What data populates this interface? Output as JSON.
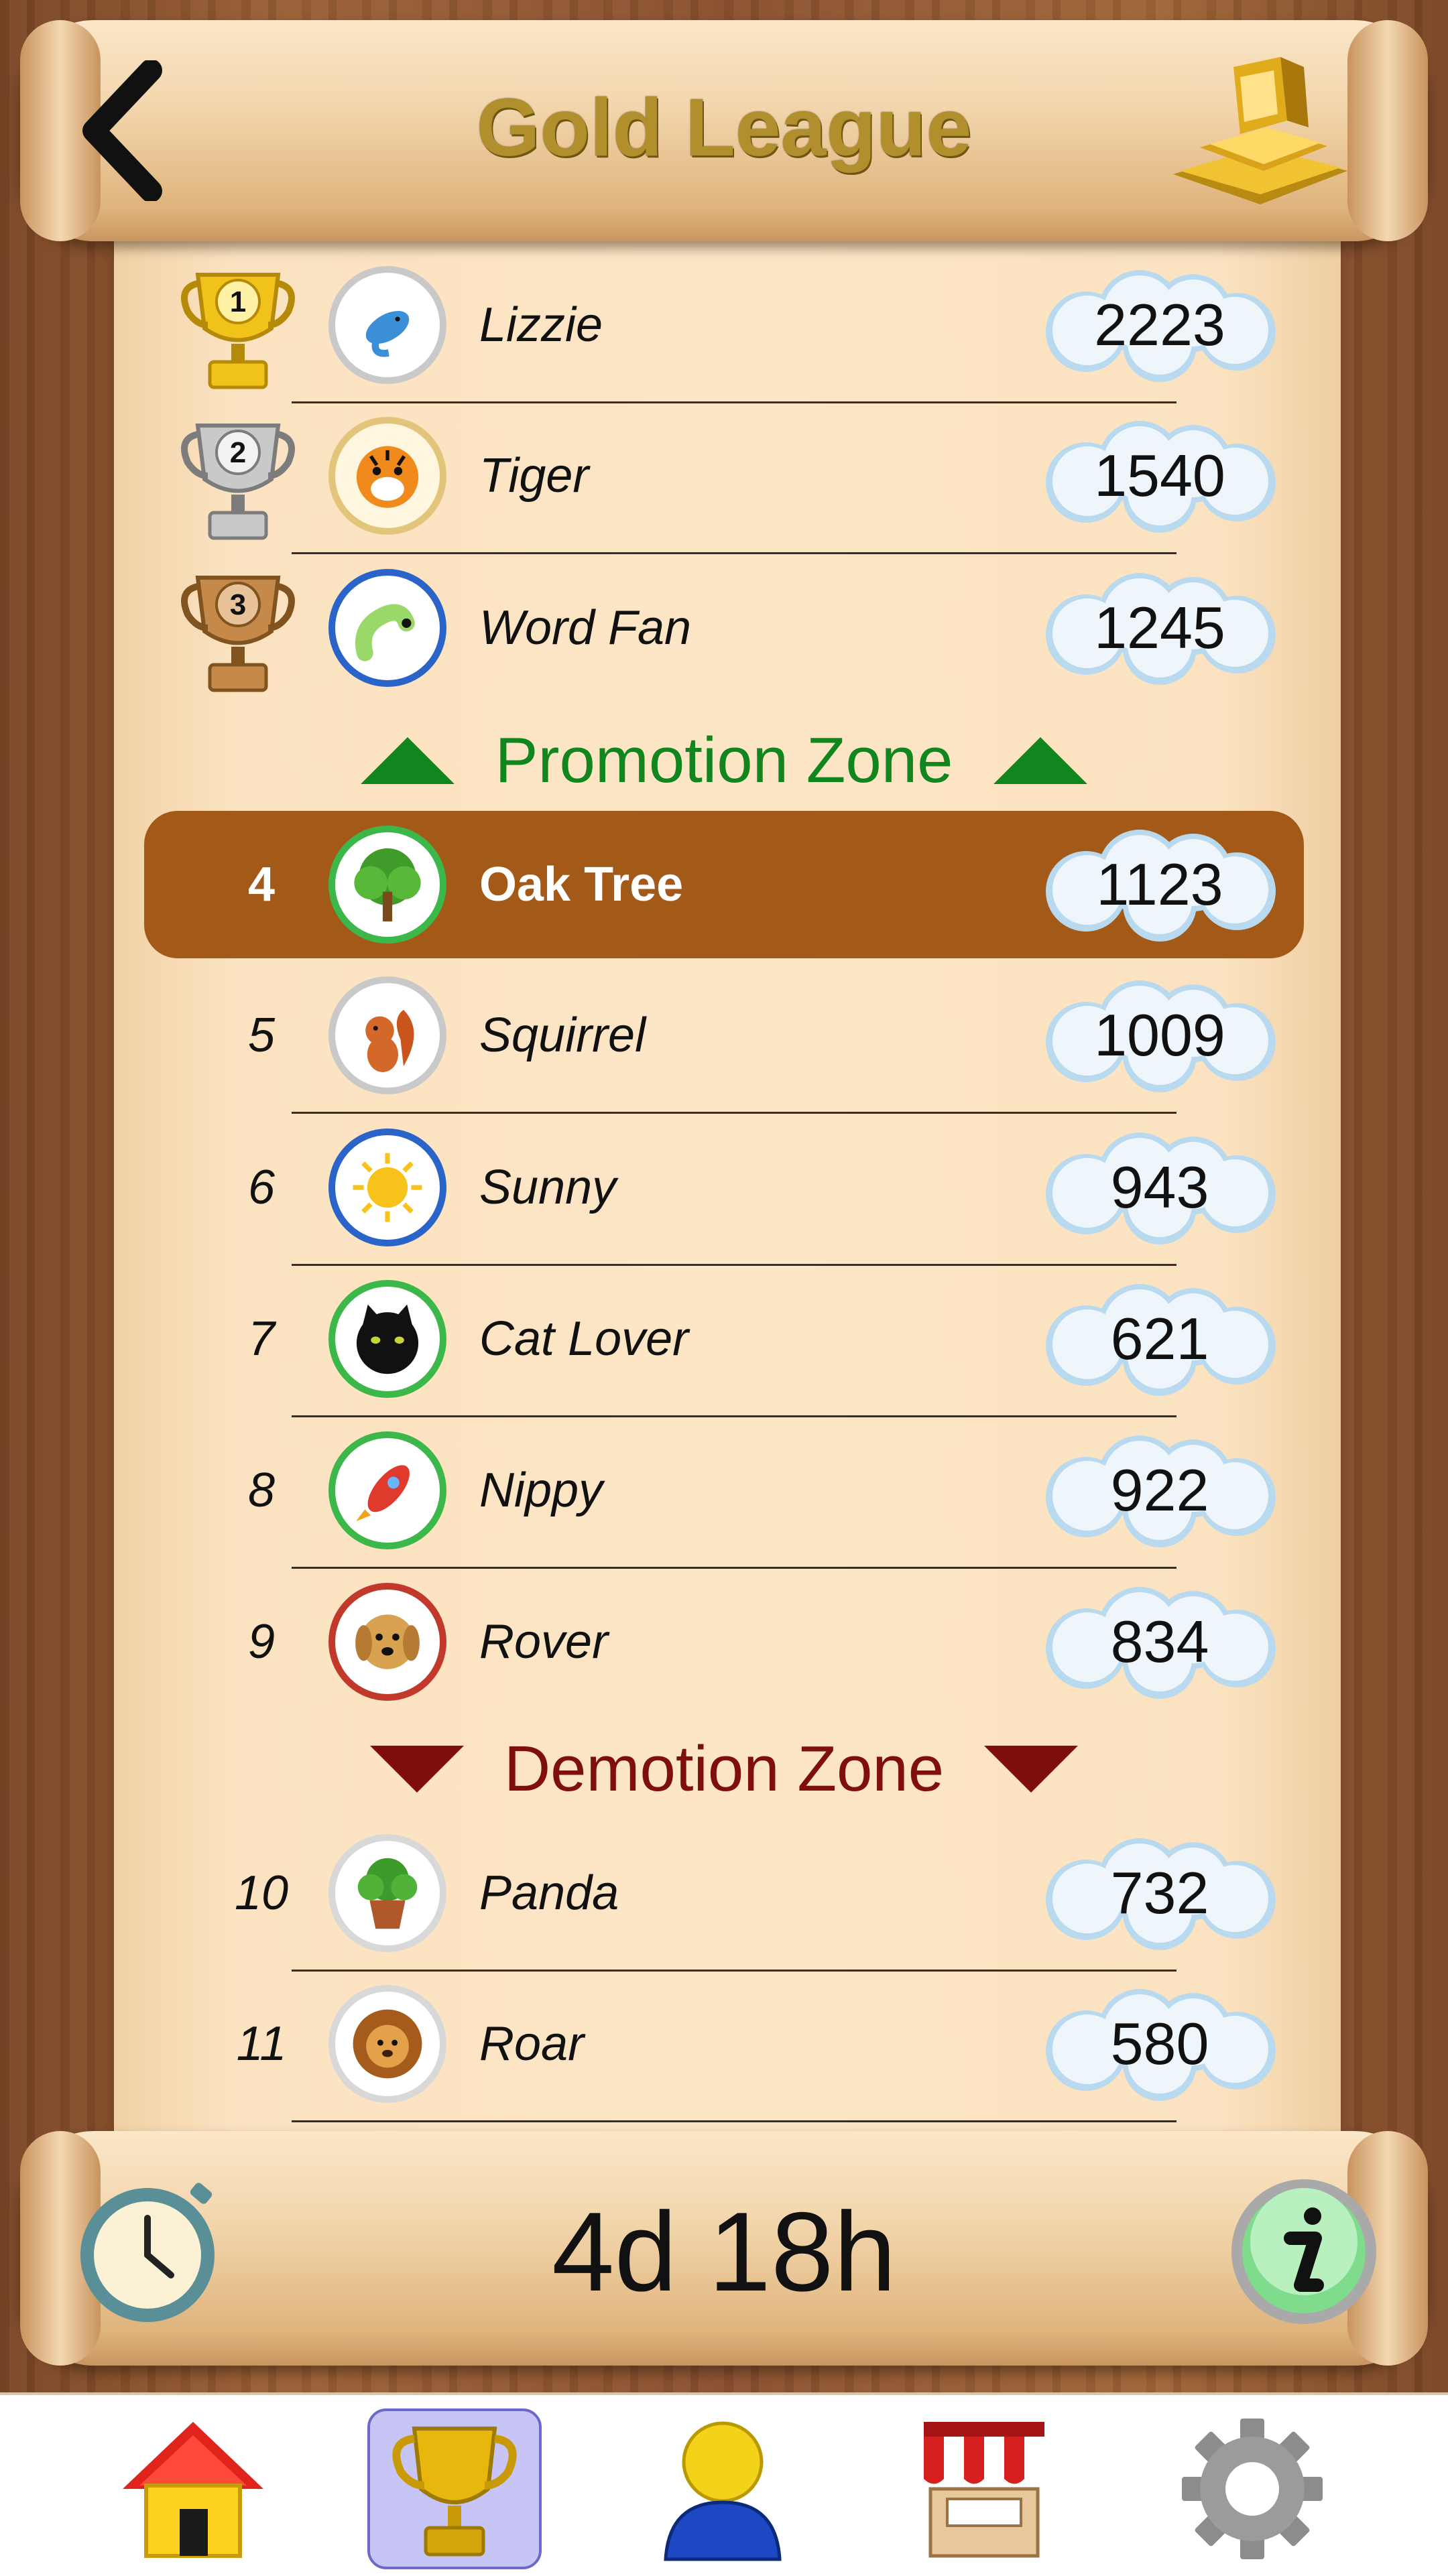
{
  "header": {
    "title": "Gold League",
    "back_icon": "chevron-left-icon",
    "league_icon": "gold-bars-icon"
  },
  "zones": {
    "promotion": "Promotion Zone",
    "demotion": "Demotion Zone"
  },
  "rows": [
    {
      "rank": "1",
      "name": "Lizzie",
      "score": "2223",
      "avatar": "dolphin",
      "trophy": "gold"
    },
    {
      "rank": "2",
      "name": "Tiger",
      "score": "1540",
      "avatar": "tiger",
      "trophy": "silver"
    },
    {
      "rank": "3",
      "name": "Word Fan",
      "score": "1245",
      "avatar": "worm",
      "trophy": "bronze"
    },
    {
      "rank": "4",
      "name": "Oak Tree",
      "score": "1123",
      "avatar": "tree",
      "highlighted": true
    },
    {
      "rank": "5",
      "name": "Squirrel",
      "score": "1009",
      "avatar": "squirrel"
    },
    {
      "rank": "6",
      "name": "Sunny",
      "score": "943",
      "avatar": "sun"
    },
    {
      "rank": "7",
      "name": "Cat Lover",
      "score": "621",
      "avatar": "cat"
    },
    {
      "rank": "8",
      "name": "Nippy",
      "score": "922",
      "avatar": "rocket"
    },
    {
      "rank": "9",
      "name": "Rover",
      "score": "834",
      "avatar": "dog"
    },
    {
      "rank": "10",
      "name": "Panda",
      "score": "732",
      "avatar": "plant"
    },
    {
      "rank": "11",
      "name": "Roar",
      "score": "580",
      "avatar": "lion"
    }
  ],
  "footer": {
    "countdown": "4d 18h",
    "timer_icon": "stopwatch-icon",
    "info_icon": "info-icon"
  },
  "tabbar": [
    {
      "label": "home",
      "icon": "home-icon"
    },
    {
      "label": "leagues",
      "icon": "trophy-icon",
      "selected": true
    },
    {
      "label": "profile",
      "icon": "user-icon"
    },
    {
      "label": "shop",
      "icon": "shop-icon"
    },
    {
      "label": "settings",
      "icon": "gear-icon"
    }
  ],
  "colors": {
    "highlight": "#a35a19",
    "promotion": "#11861e",
    "demotion": "#7e0f0a",
    "title": "#b18f2c"
  }
}
